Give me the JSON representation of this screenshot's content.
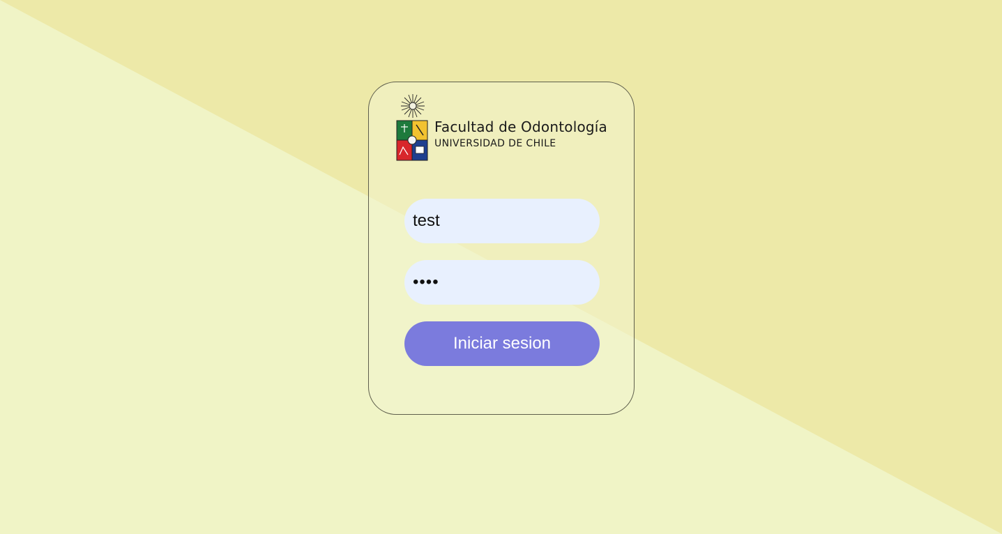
{
  "background": {
    "color_light": "#f0f4c6",
    "color_dark": "#ede9a8"
  },
  "brand": {
    "title": "Facultad de Odontología",
    "subtitle": "UNIVERSIDAD DE CHILE",
    "crest_icon": "university-crest-icon"
  },
  "login": {
    "username_value": "test",
    "password_value": "test",
    "submit_label": "Iniciar sesion",
    "accent_color": "#7b7bdd",
    "field_color": "#e8f0fe"
  }
}
